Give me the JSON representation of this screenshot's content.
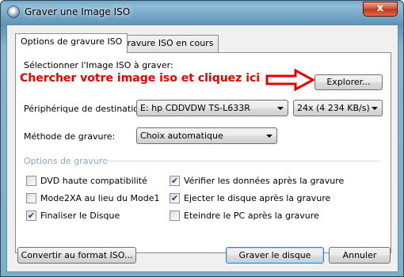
{
  "window": {
    "title": "Graver une Image ISO",
    "close_glyph": "x"
  },
  "tabs": [
    {
      "label": "Options de gravure ISO",
      "active": true
    },
    {
      "label": "Gravure ISO en cours",
      "active": false
    }
  ],
  "image_section": {
    "label": "Sélectionner l'Image ISO à graver:",
    "annotation": "Chercher votre image iso et cliquez ici",
    "annotation_color": "#e60000",
    "browse_button": "Explorer..."
  },
  "destination": {
    "label": "Périphérique de destination:",
    "drive_value": "E: hp CDDVDW TS-L633R",
    "speed_value": "24x (4 234 KB/s)"
  },
  "method": {
    "label": "Méthode de gravure:",
    "value": "Choix automatique"
  },
  "options": {
    "group_label": "Options de gravure",
    "group_label_color": "#8ea8bd",
    "checkboxes": [
      {
        "label": "DVD haute compatibilité",
        "checked": false
      },
      {
        "label": "Vérifier les données après la gravure",
        "checked": true
      },
      {
        "label": "Mode2XA au lieu du Mode1",
        "checked": false
      },
      {
        "label": "Ejecter le disque après la gravure",
        "checked": true
      },
      {
        "label": "Finaliser le Disque",
        "checked": true
      },
      {
        "label": "Eteindre le PC après la gravure",
        "checked": false
      }
    ]
  },
  "footer": {
    "convert_button": "Convertir au format ISO...",
    "burn_button": "Graver le disque",
    "cancel_button": "Annuler"
  },
  "icons": {
    "app": "disc-icon",
    "close": "close-icon",
    "arrow": "arrow-right-icon",
    "dropdown": "chevron-down-icon"
  }
}
